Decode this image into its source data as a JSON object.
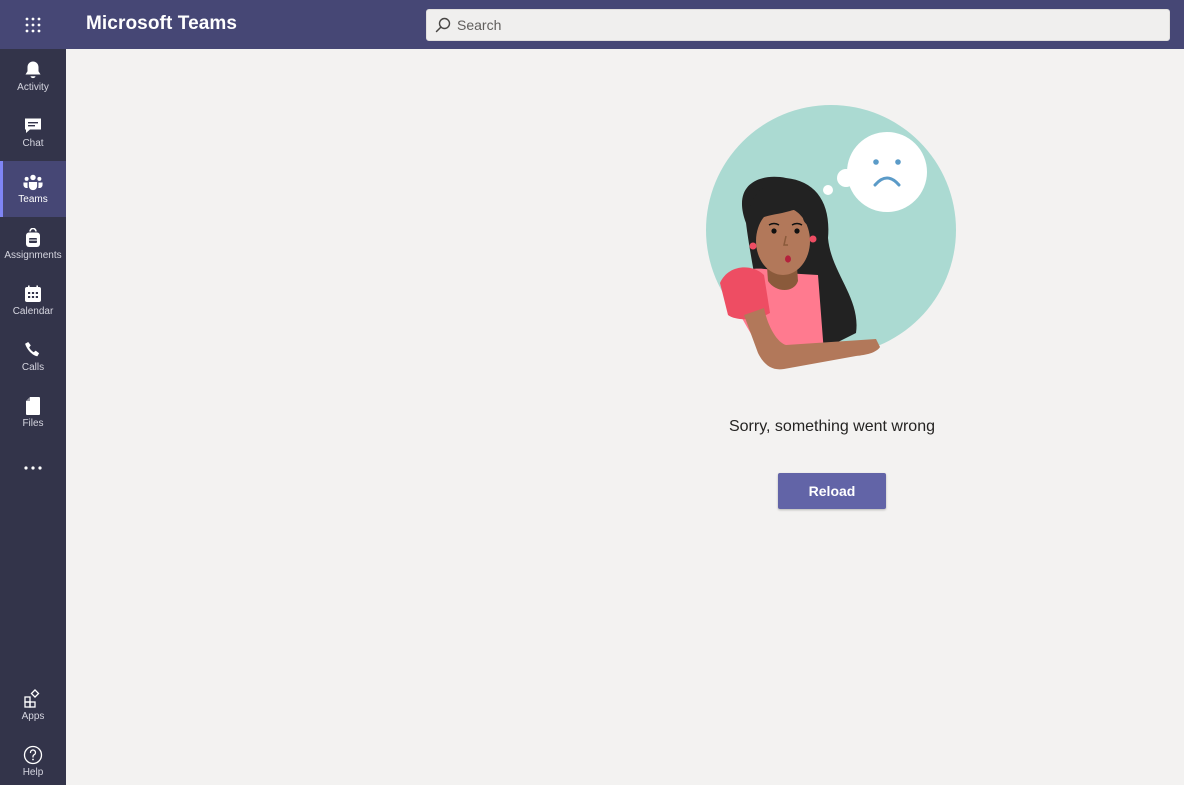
{
  "header": {
    "app_title": "Microsoft Teams",
    "search_placeholder": "Search"
  },
  "rail": {
    "items": [
      {
        "label": "Activity",
        "icon": "bell-icon"
      },
      {
        "label": "Chat",
        "icon": "chat-icon"
      },
      {
        "label": "Teams",
        "icon": "teams-icon",
        "active": true
      },
      {
        "label": "Assignments",
        "icon": "backpack-icon"
      },
      {
        "label": "Calendar",
        "icon": "calendar-icon"
      },
      {
        "label": "Calls",
        "icon": "phone-icon"
      },
      {
        "label": "Files",
        "icon": "file-icon"
      }
    ],
    "more_icon": "ellipsis-icon",
    "bottom_items": [
      {
        "label": "Apps",
        "icon": "apps-icon"
      },
      {
        "label": "Help",
        "icon": "help-icon"
      }
    ]
  },
  "main": {
    "error_message": "Sorry, something went wrong",
    "reload_label": "Reload"
  },
  "colors": {
    "header": "#464775",
    "rail": "#33344a",
    "accent": "#6264a7",
    "background": "#f3f2f1"
  }
}
